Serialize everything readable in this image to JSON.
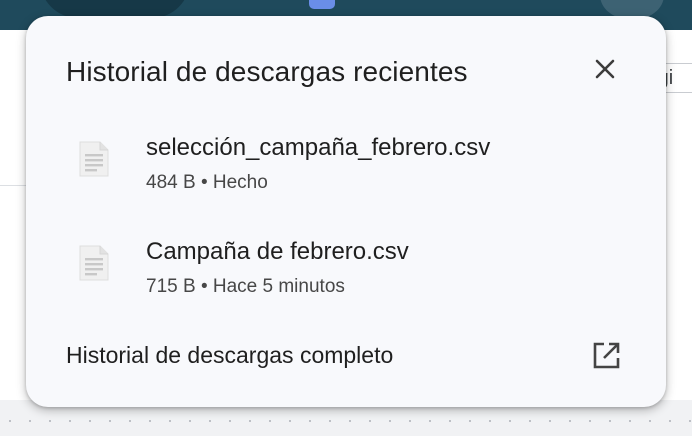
{
  "background": {
    "right_chip_text": "rgi",
    "topbar_color": "#1f4a5c"
  },
  "popup": {
    "title": "Historial de descargas recientes",
    "close_icon": "close-icon",
    "items": [
      {
        "name": "selección_campaña_febrero.csv",
        "size": "484 B",
        "separator": "•",
        "status": "Hecho",
        "icon": "file-icon"
      },
      {
        "name": "Campaña de febrero.csv",
        "size": "715 B",
        "separator": "•",
        "status": "Hace 5 minutos",
        "icon": "file-icon"
      }
    ],
    "full_history_label": "Historial de descargas completo",
    "open_external_icon": "open-in-new-icon"
  }
}
